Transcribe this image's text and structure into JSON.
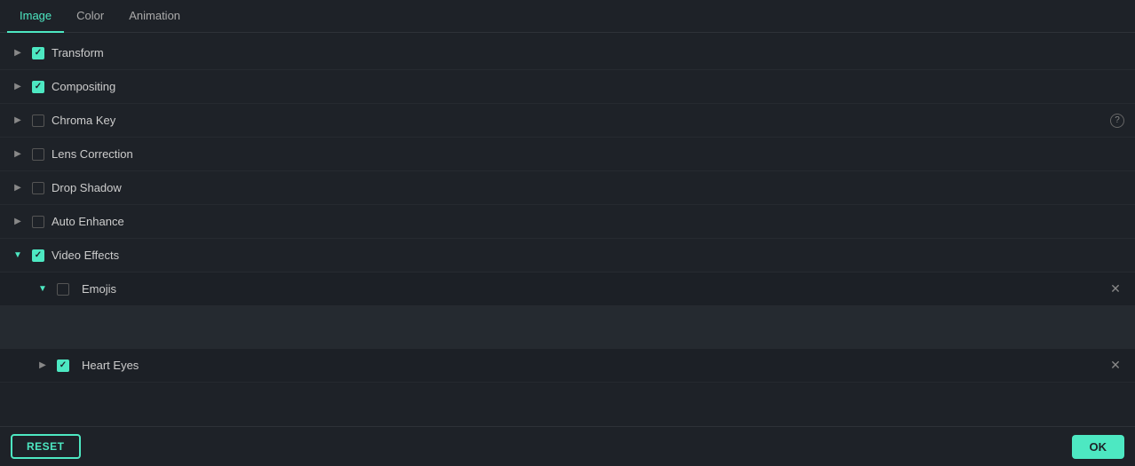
{
  "tabs": [
    {
      "id": "image",
      "label": "Image",
      "active": true
    },
    {
      "id": "color",
      "label": "Color",
      "active": false
    },
    {
      "id": "animation",
      "label": "Animation",
      "active": false
    }
  ],
  "properties": [
    {
      "id": "transform",
      "label": "Transform",
      "checked": true,
      "expanded": false,
      "indent": 0
    },
    {
      "id": "compositing",
      "label": "Compositing",
      "checked": true,
      "expanded": false,
      "indent": 0
    },
    {
      "id": "chroma-key",
      "label": "Chroma Key",
      "checked": false,
      "expanded": false,
      "indent": 0,
      "hasHelp": true
    },
    {
      "id": "lens-correction",
      "label": "Lens Correction",
      "checked": false,
      "expanded": false,
      "indent": 0
    },
    {
      "id": "drop-shadow",
      "label": "Drop Shadow",
      "checked": false,
      "expanded": false,
      "indent": 0
    },
    {
      "id": "auto-enhance",
      "label": "Auto Enhance",
      "checked": false,
      "expanded": false,
      "indent": 0
    },
    {
      "id": "video-effects",
      "label": "Video Effects",
      "checked": true,
      "expanded": true,
      "indent": 0
    }
  ],
  "videoEffectsChildren": [
    {
      "id": "emojis",
      "label": "Emojis",
      "checked": false,
      "expanded": true
    },
    {
      "id": "heart-eyes",
      "label": "Heart Eyes",
      "checked": true,
      "expanded": false
    }
  ],
  "footer": {
    "reset_label": "RESET",
    "ok_label": "OK"
  }
}
